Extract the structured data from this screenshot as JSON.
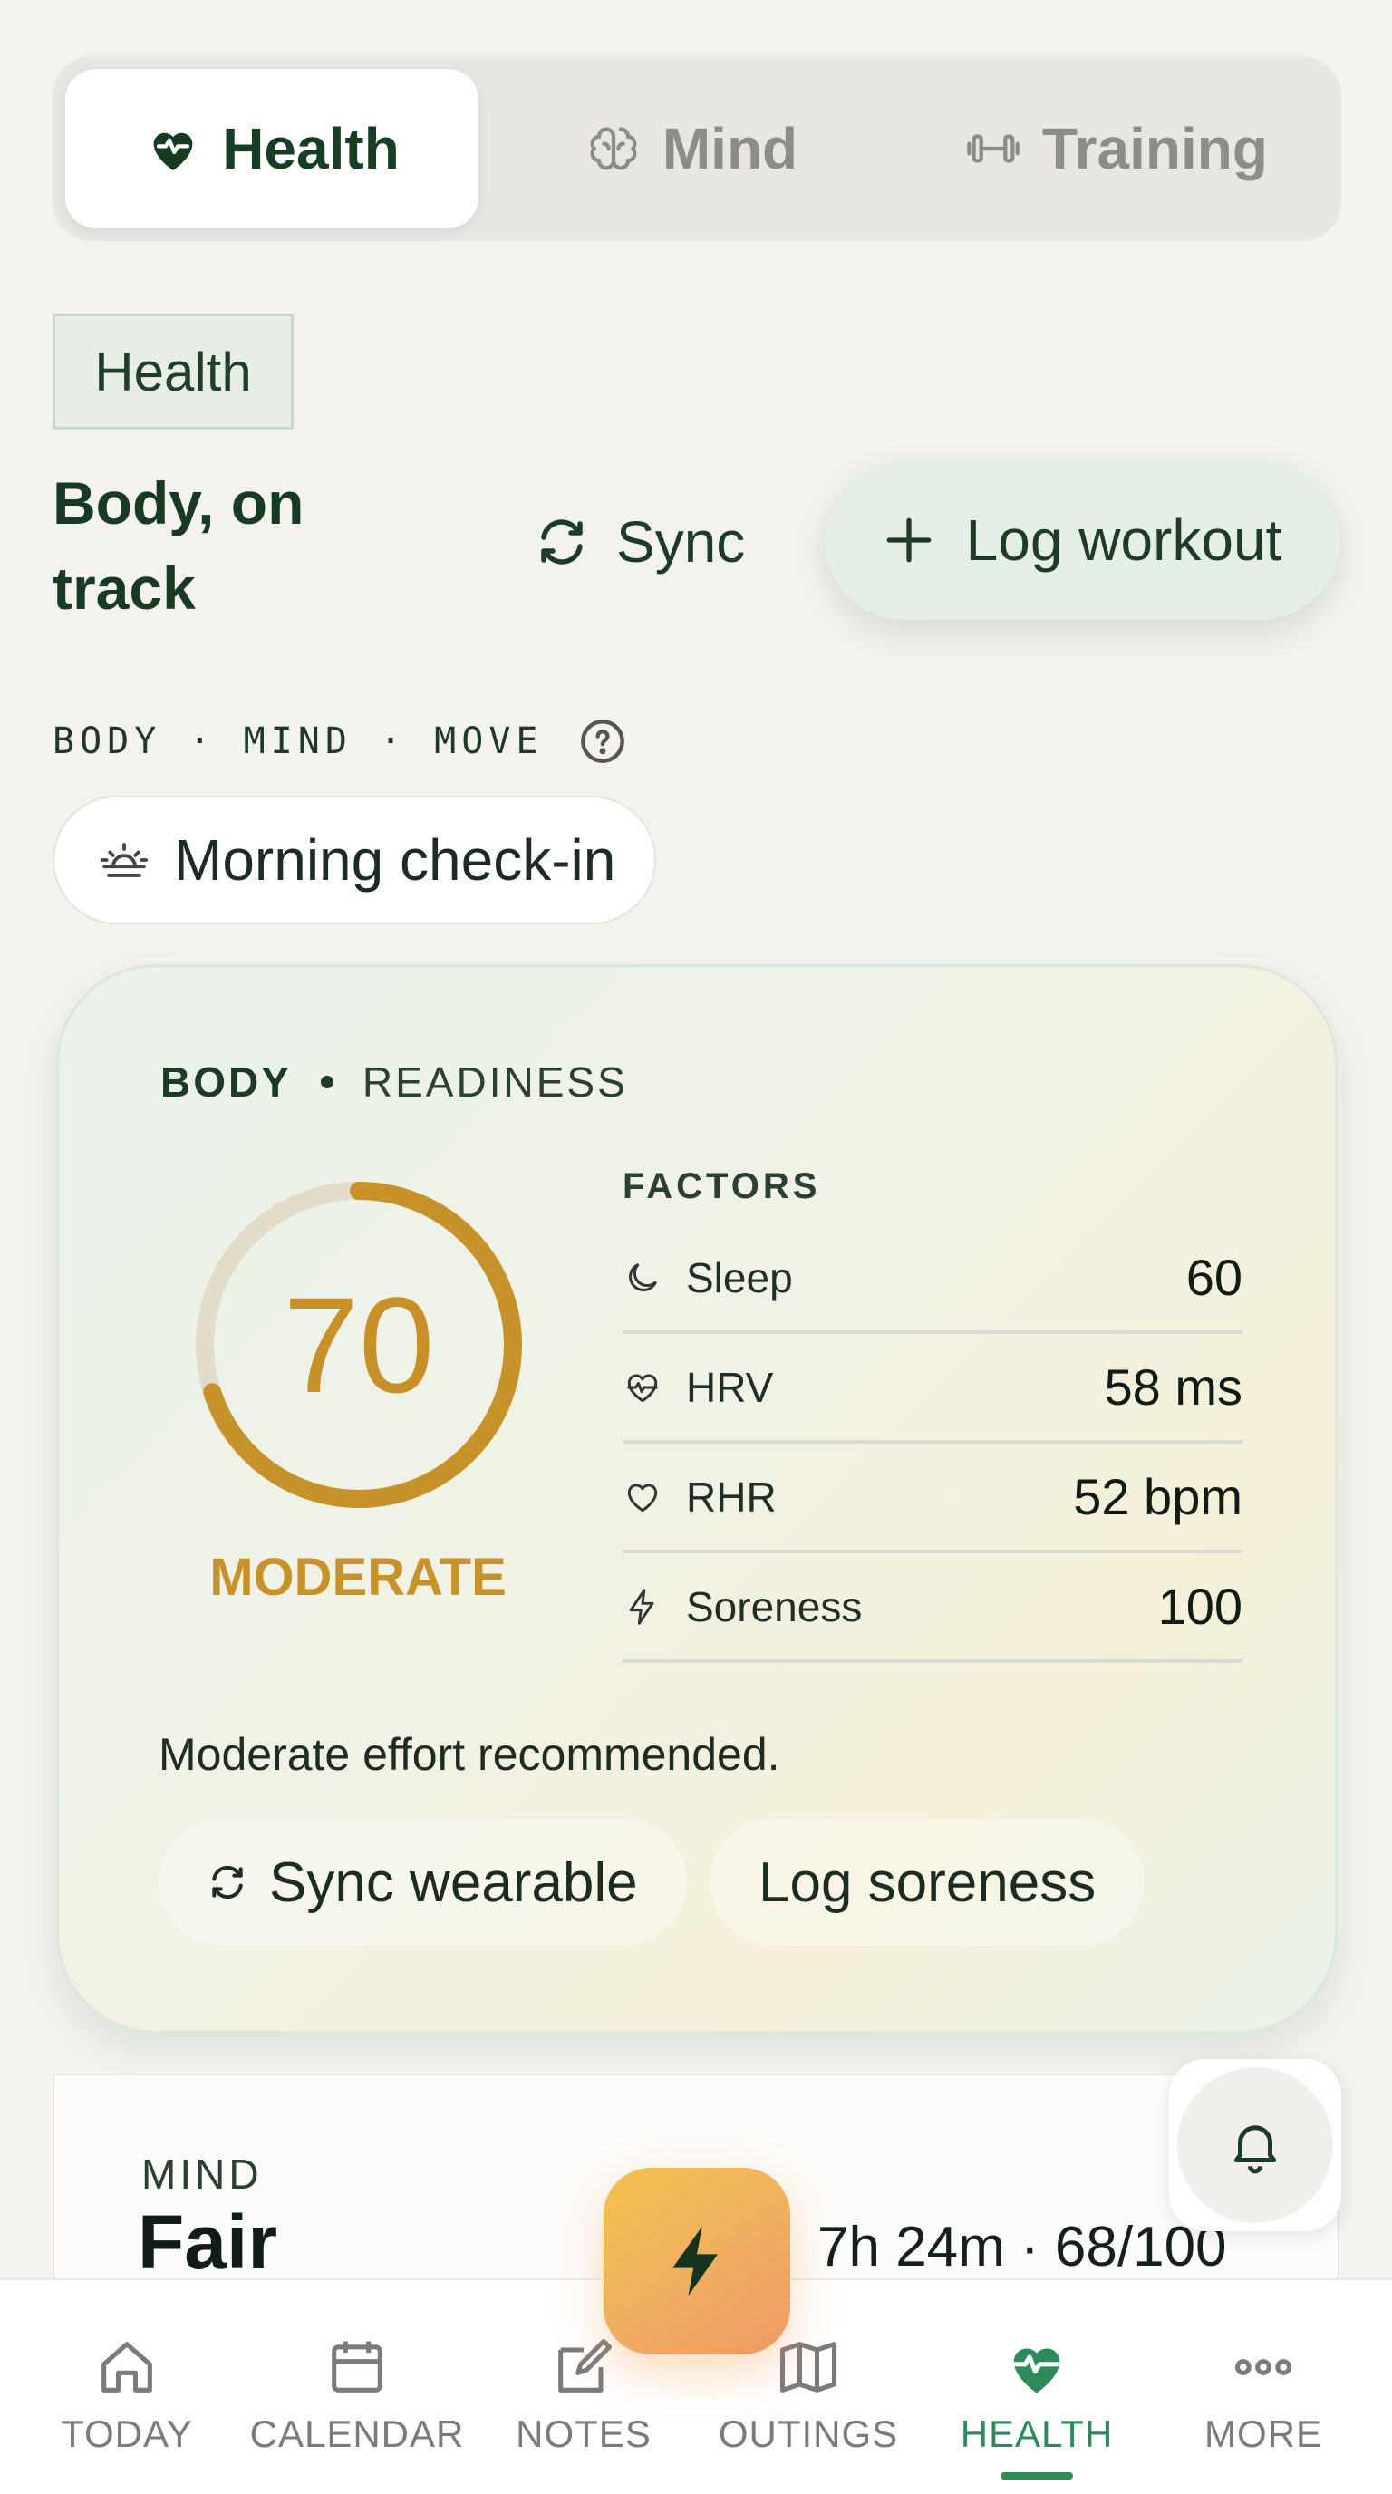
{
  "tabs": [
    {
      "label": "Health",
      "icon": "heart-pulse-icon",
      "active": true
    },
    {
      "label": "Mind",
      "icon": "brain-icon",
      "active": false
    },
    {
      "label": "Training",
      "icon": "dumbbell-icon",
      "active": false
    }
  ],
  "header": {
    "section_chip": "Health",
    "title": "Body, on track",
    "sync_label": "Sync",
    "log_workout_label": "Log workout"
  },
  "eyebrow": "BODY · MIND · MOVE",
  "checkin_label": "Morning check-in",
  "readiness": {
    "label_main": "BODY",
    "label_sub": "READINESS",
    "score": "70",
    "score_fraction": 0.7,
    "state": "MODERATE",
    "factors_title": "FACTORS",
    "factors": [
      {
        "name": "Sleep",
        "value": "60",
        "icon": "moon-icon"
      },
      {
        "name": "HRV",
        "value": "58 ms",
        "icon": "heart-pulse-icon"
      },
      {
        "name": "RHR",
        "value": "52 bpm",
        "icon": "heart-icon"
      },
      {
        "name": "Soreness",
        "value": "100",
        "icon": "bolt-icon"
      }
    ],
    "note": "Moderate effort recommended.",
    "sync_wearable_label": "Sync wearable",
    "log_soreness_label": "Log soreness",
    "ring_color": "#c8922a",
    "ring_track_color": "#e3dcc9"
  },
  "mind": {
    "label": "MIND",
    "state": "Fair",
    "meta": "7h 24m · 68/100"
  },
  "nav": [
    {
      "label": "TODAY",
      "icon": "home-icon",
      "active": false
    },
    {
      "label": "CALENDAR",
      "icon": "calendar-icon",
      "active": false
    },
    {
      "label": "NOTES",
      "icon": "edit-icon",
      "active": false
    },
    {
      "label": "OUTINGS",
      "icon": "map-icon",
      "active": false
    },
    {
      "label": "HEALTH",
      "icon": "heart-pulse-icon",
      "active": true
    },
    {
      "label": "MORE",
      "icon": "more-icon",
      "active": false
    }
  ],
  "colors": {
    "accent_green": "#2e8a5a",
    "dark_green": "#163a22",
    "gold": "#c8922a"
  }
}
